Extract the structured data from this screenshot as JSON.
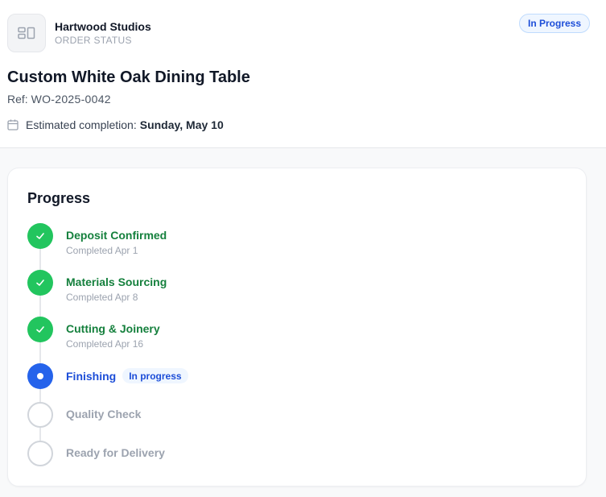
{
  "brand": {
    "name": "Hartwood Studios",
    "subtitle": "ORDER STATUS"
  },
  "status": {
    "label": "In Progress"
  },
  "order": {
    "title": "Custom White Oak Dining Table",
    "ref_label": "Ref: ",
    "ref_value": "WO-2025-0042",
    "eta_label": "Estimated completion:",
    "eta_date": "Sunday, May 10"
  },
  "progress": {
    "title": "Progress",
    "steps": [
      {
        "label": "Deposit Confirmed",
        "date": "Completed Apr 1",
        "state": "done"
      },
      {
        "label": "Materials Sourcing",
        "date": "Completed Apr 8",
        "state": "done"
      },
      {
        "label": "Cutting & Joinery",
        "date": "Completed Apr 16",
        "state": "done"
      },
      {
        "label": "Finishing",
        "badge": "In progress",
        "state": "active"
      },
      {
        "label": "Quality Check",
        "state": "pending"
      },
      {
        "label": "Ready for Delivery",
        "state": "pending"
      }
    ]
  },
  "colors": {
    "done": "#22c55e",
    "active": "#2563eb",
    "pending": "#d1d5db"
  },
  "icons": {
    "logo": "gallery-layout-icon",
    "eta": "calendar-icon",
    "done": "check-icon",
    "active": "dot-icon"
  }
}
